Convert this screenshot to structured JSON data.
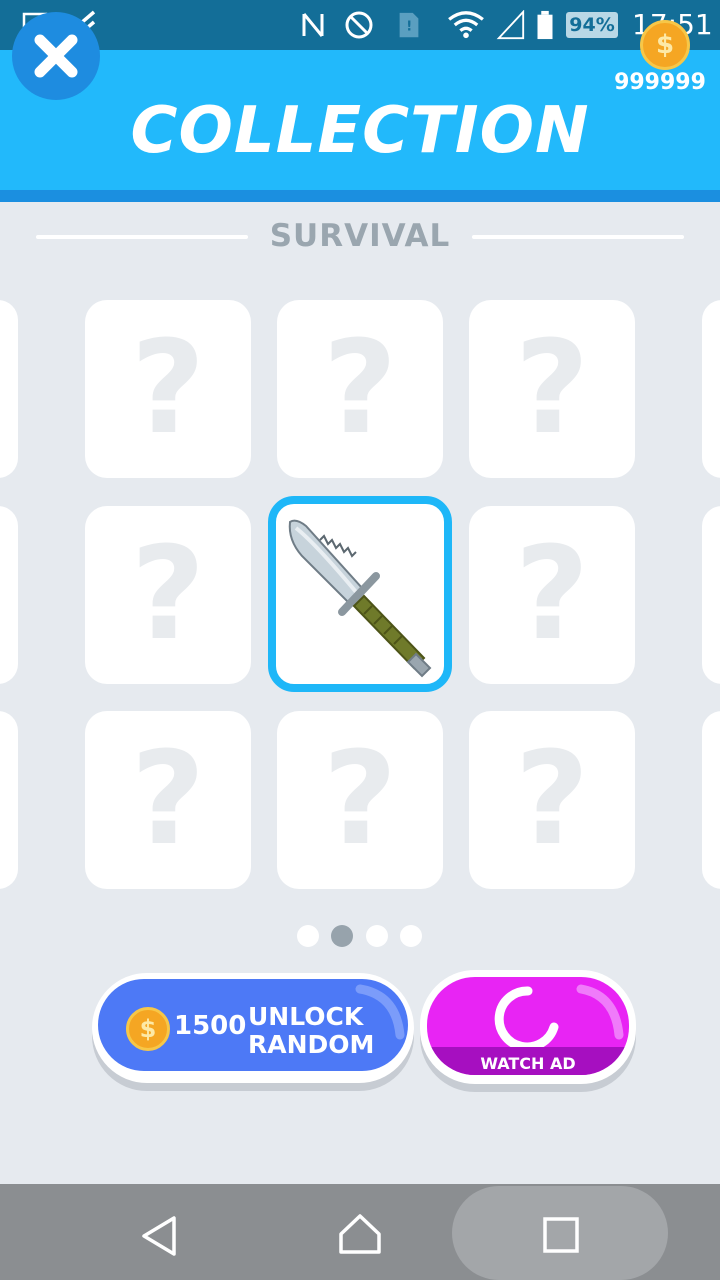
{
  "status_bar": {
    "battery_percent": "94%",
    "time": "17:51",
    "icons": [
      "image-icon",
      "checkmark-icon",
      "nfc-icon",
      "do-not-disturb-icon",
      "sim-icon",
      "wifi-icon",
      "signal-icon",
      "battery-icon"
    ]
  },
  "header": {
    "title": "COLLECTION",
    "coins": "999999"
  },
  "section": {
    "title": "SURVIVAL"
  },
  "grid": {
    "placeholder": "?",
    "selected_item": "knife-icon"
  },
  "pager": {
    "pages": 4,
    "active_index": 1
  },
  "buttons": {
    "unlock_price": "1500",
    "unlock_line1": "UNLOCK",
    "unlock_line2": "RANDOM",
    "watch_ad": "WATCH AD"
  },
  "colors": {
    "header_blue": "#22b9fb",
    "unlock_blue": "#4d79f6",
    "ad_magenta": "#e824f4",
    "selected_border": "#1eb7f8"
  },
  "nav": {
    "icons": [
      "back-icon",
      "home-icon",
      "recents-icon"
    ]
  }
}
